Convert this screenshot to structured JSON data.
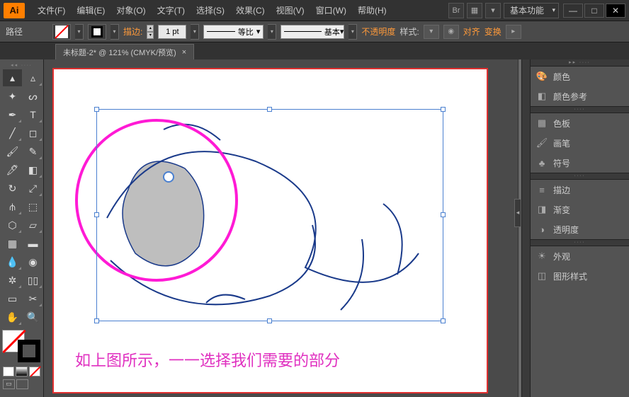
{
  "app": {
    "logo": "Ai"
  },
  "menu": {
    "file": "文件(F)",
    "edit": "编辑(E)",
    "object": "对象(O)",
    "type": "文字(T)",
    "select": "选择(S)",
    "effect": "效果(C)",
    "view": "视图(V)",
    "window": "窗口(W)",
    "help": "帮助(H)"
  },
  "titlebar": {
    "workspace": "基本功能",
    "br": "Br"
  },
  "options": {
    "mode_label": "路径",
    "stroke_label": "描边:",
    "stroke_pt": "1 pt",
    "profile_label": "等比",
    "style_label": "基本",
    "opacity_label": "不透明度",
    "styles_label": "样式:",
    "align_label": "对齐",
    "transform_label": "变换"
  },
  "tab": {
    "title": "未标题-2* @ 121% (CMYK/预览)"
  },
  "panels": {
    "color": "颜色",
    "color_guide": "颜色参考",
    "swatches": "色板",
    "brushes": "画笔",
    "symbols": "符号",
    "stroke": "描边",
    "gradient": "渐变",
    "transparency": "透明度",
    "appearance": "外观",
    "graphic_styles": "图形样式"
  },
  "canvas": {
    "caption": "如上图所示，一一选择我们需要的部分"
  }
}
